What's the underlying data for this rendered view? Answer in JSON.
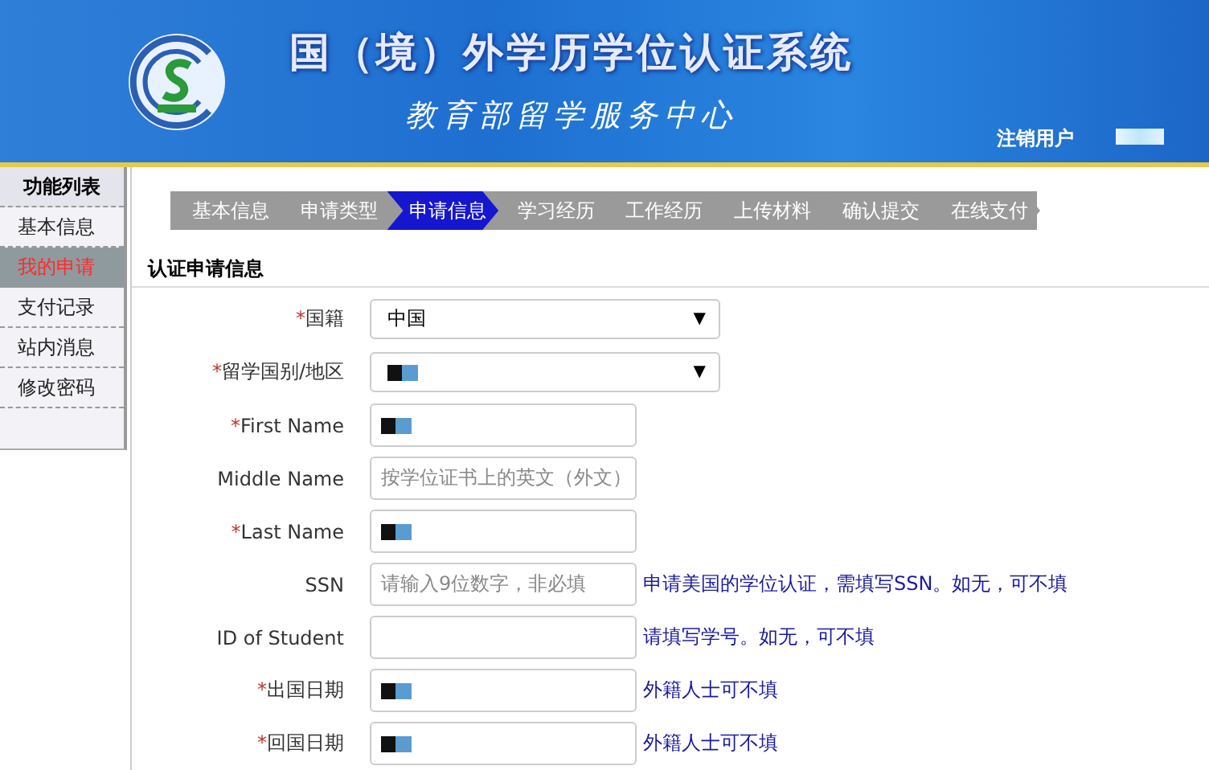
{
  "header": {
    "title": "国（境）外学历学位认证系统",
    "subtitle": "教育部留学服务中心",
    "logout": "注销用户",
    "user_redacted": true
  },
  "sidebar": {
    "heading": "功能列表",
    "items": [
      {
        "label": "基本信息",
        "selected": false
      },
      {
        "label": "我的申请",
        "selected": true
      },
      {
        "label": "支付记录",
        "selected": false
      },
      {
        "label": "站内消息",
        "selected": false
      },
      {
        "label": "修改密码",
        "selected": false
      }
    ]
  },
  "steps": [
    {
      "label": "基本信息",
      "selected": false
    },
    {
      "label": "申请类型",
      "selected": false
    },
    {
      "label": "申请信息",
      "selected": true
    },
    {
      "label": "学习经历",
      "selected": false
    },
    {
      "label": "工作经历",
      "selected": false
    },
    {
      "label": "上传材料",
      "selected": false
    },
    {
      "label": "确认提交",
      "selected": false
    },
    {
      "label": "在线支付",
      "selected": false
    }
  ],
  "section_title": "认证申请信息",
  "fields": [
    {
      "kind": "select",
      "label": "国籍",
      "required_mark": "*",
      "value": "中国",
      "caret": "▼"
    },
    {
      "kind": "select",
      "label": "留学国别/地区",
      "required_mark": "*",
      "redacted": true,
      "caret": "▼"
    },
    {
      "kind": "text",
      "label": "First Name",
      "required_mark": "*",
      "redacted": true
    },
    {
      "kind": "text",
      "label": "Middle Name",
      "placeholder": "按学位证书上的英文（外文）"
    },
    {
      "kind": "text",
      "label": "Last Name",
      "required_mark": "*",
      "redacted": true
    },
    {
      "kind": "text",
      "label": "SSN",
      "placeholder": "请输入9位数字，非必填",
      "hint": "申请美国的学位认证，需填写SSN。如无，可不填"
    },
    {
      "kind": "text",
      "label": "ID of Student",
      "hint": "请填写学号。如无，可不填"
    },
    {
      "kind": "text",
      "label": "出国日期",
      "required_mark": "*",
      "redacted": true,
      "hint": "外籍人士可不填"
    },
    {
      "kind": "text",
      "label": "回国日期",
      "required_mark": "*",
      "redacted": true,
      "hint": "外籍人士可不填"
    }
  ]
}
